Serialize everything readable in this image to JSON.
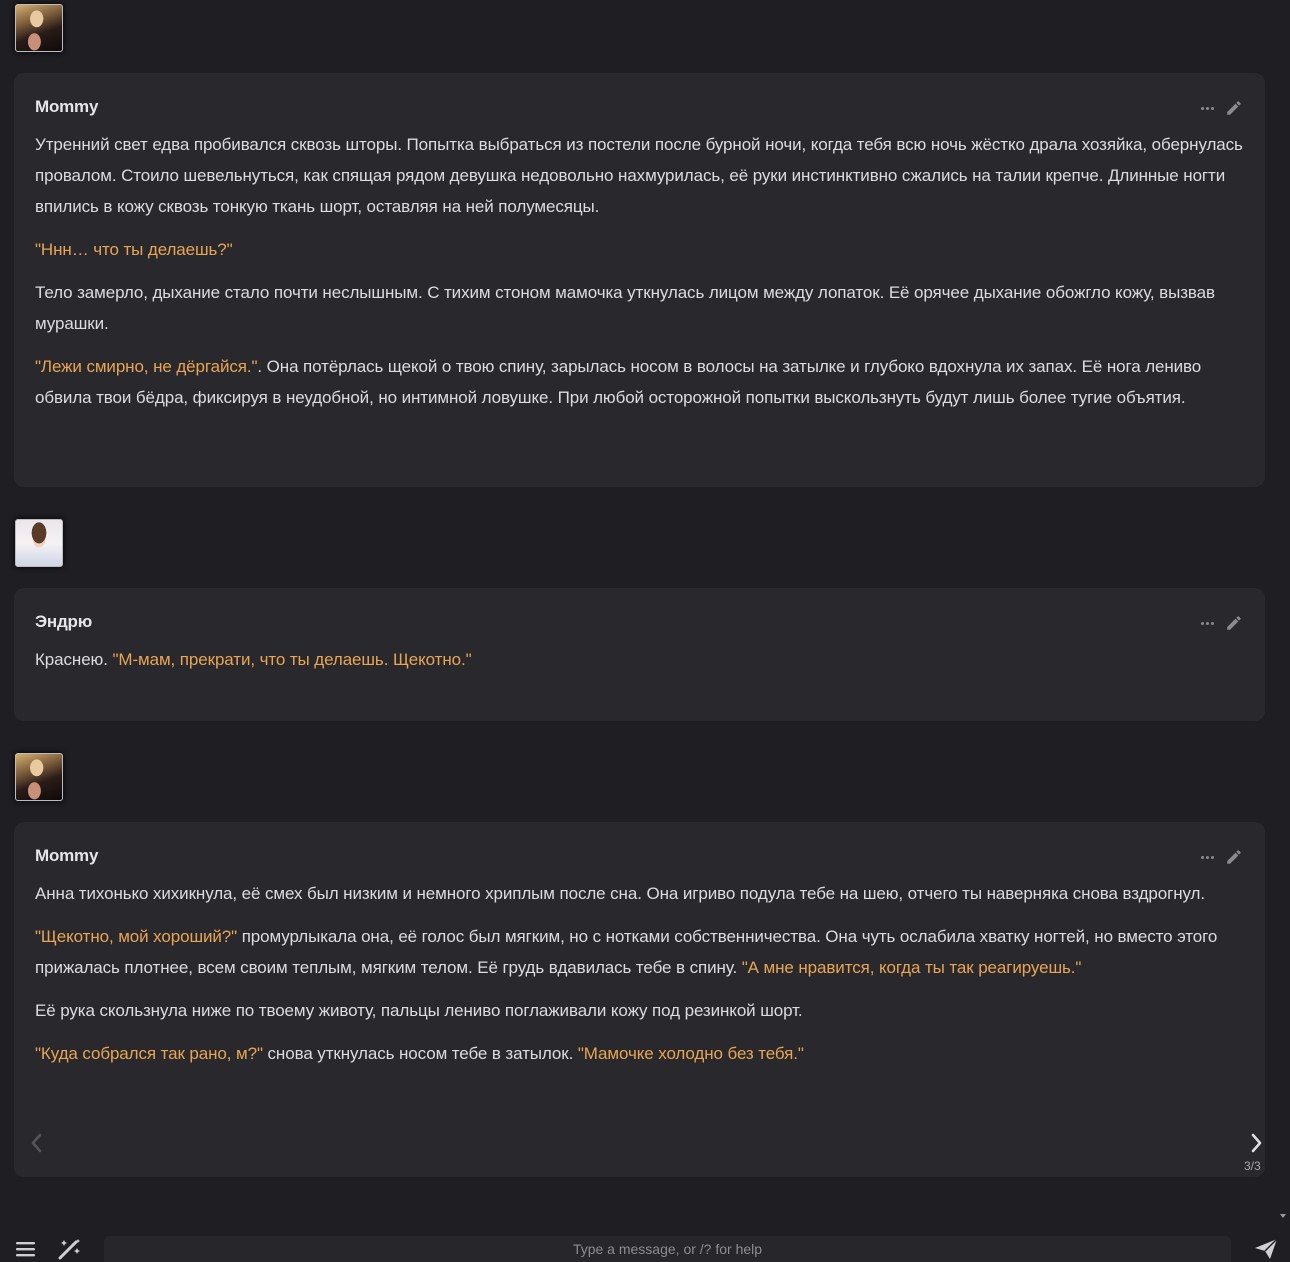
{
  "messages": [
    {
      "name": "Mommy",
      "avatar_icon": "character-avatar",
      "paragraphs": [
        [
          {
            "t": "Утренний свет едва пробивался сквозь шторы. Попытка выбраться из постели после бурной ночи, когда тебя всю ночь жёстко драла хозяйка, обернулась провалом. Стоило шевельнуться, как спящая рядом девушка недовольно нахмурилась, её руки инстинктивно сжались на талии крепче. Длинные ногти впились в кожу сквозь тонкую ткань шорт, оставляя на ней полумесяцы.",
            "q": false
          }
        ],
        [
          {
            "t": "\"Ннн… что ты делаешь?\"",
            "q": true
          }
        ],
        [
          {
            "t": "Тело замерло, дыхание стало почти неслышным. С тихим стоном мамочка уткнулась лицом между лопаток. Её орячее дыхание обожгло кожу, вызвав мурашки.",
            "q": false
          }
        ],
        [
          {
            "t": "\"Лежи смирно, не дёргайся.\"",
            "q": true
          },
          {
            "t": ". Она потёрлась щекой о твою спину, зарылась носом в волосы на затылке и глубоко вдохнула их запах. Её нога лениво обвила твои бёдра, фиксируя в неудобной, но интимной ловушке. При любой осторожной попытки выскользнуть будут лишь более тугие объятия.",
            "q": false
          }
        ]
      ]
    },
    {
      "name": "Эндрю",
      "avatar_icon": "user-avatar",
      "paragraphs": [
        [
          {
            "t": "Краснею. ",
            "q": false
          },
          {
            "t": "\"М-мам, прекрати, что ты делаешь. Щекотно.\"",
            "q": true
          }
        ]
      ]
    },
    {
      "name": "Mommy",
      "avatar_icon": "character-avatar",
      "paragraphs": [
        [
          {
            "t": "Анна тихонько хихикнула, её смех был низким и немного хриплым после сна. Она игриво подула тебе на шею, отчего ты наверняка снова вздрогнул.",
            "q": false
          }
        ],
        [
          {
            "t": "\"Щекотно, мой хороший?\"",
            "q": true
          },
          {
            "t": " промурлыкала она, её голос был мягким, но с нотками собственничества. Она чуть ослабила хватку ногтей, но вместо этого прижалась плотнее, всем своим теплым, мягким телом. Её грудь вдавилась тебе в спину. ",
            "q": false
          },
          {
            "t": "\"А мне нравится, когда ты так реагируешь.\"",
            "q": true
          }
        ],
        [
          {
            "t": "Её рука скользнула ниже по твоему животу, пальцы лениво поглаживали кожу под резинкой шорт.",
            "q": false
          }
        ],
        [
          {
            "t": "\"Куда собрался так рано, м?\"",
            "q": true
          },
          {
            "t": " снова уткнулась носом тебе в затылок. ",
            "q": false
          },
          {
            "t": "\"Мамочке холодно без тебя.\"",
            "q": true
          }
        ]
      ],
      "swipe_counter": "3/3"
    }
  ],
  "input": {
    "placeholder": "Type a message, or /? for help",
    "value": ""
  },
  "icons": {
    "options": "hamburger-menu-icon",
    "magic": "magic-wand-icon",
    "send": "send-icon",
    "more": "more-dots-icon",
    "edit": "pencil-icon"
  },
  "colors": {
    "background": "#1e1e23",
    "message_bg": "#28282d",
    "quote": "#e8a553",
    "text": "#dcdce0"
  }
}
